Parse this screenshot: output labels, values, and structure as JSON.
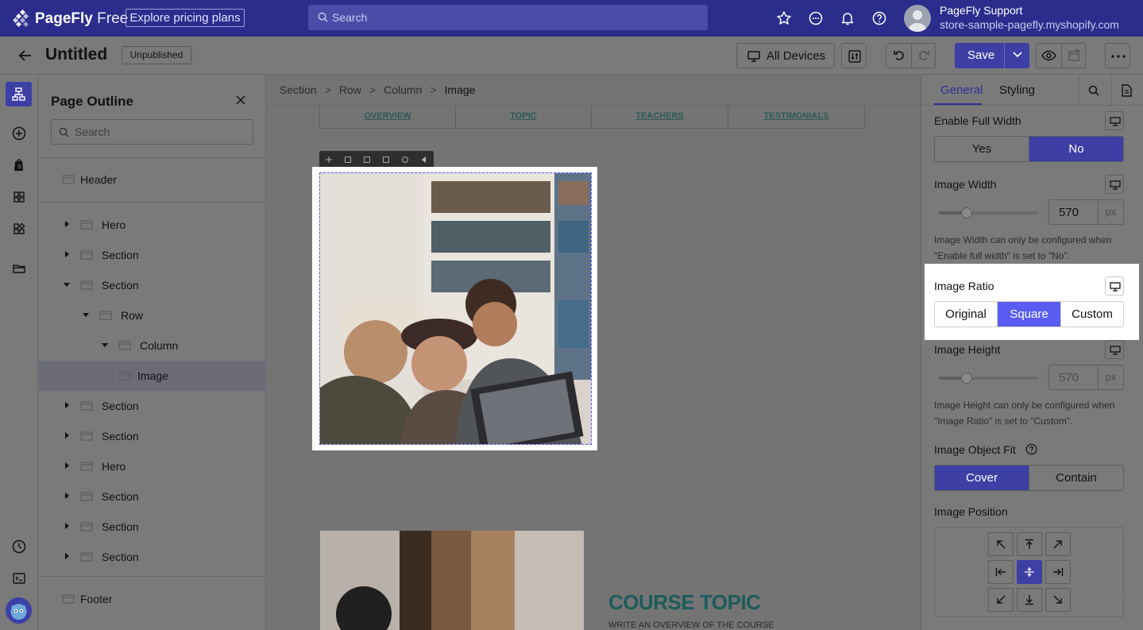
{
  "topbar": {
    "brand_name": "PageFly",
    "brand_tier": "Free",
    "pricing_label": "Explore pricing plans",
    "search_placeholder": "Search",
    "user_name": "PageFly Support",
    "user_store": "store-sample-pagefly.myshopify.com",
    "icons": [
      "star-icon",
      "chat-icon",
      "bell-icon",
      "help-icon"
    ]
  },
  "header": {
    "title": "Untitled",
    "status": "Unpublished",
    "devices_label": "All Devices",
    "save_label": "Save"
  },
  "outline": {
    "title": "Page Outline",
    "search_placeholder": "Search",
    "items": [
      {
        "label": "Header",
        "level": 0,
        "expandable": false,
        "selected": false
      },
      {
        "label": "Hero",
        "level": 0,
        "expandable": true,
        "expanded": false,
        "selected": false
      },
      {
        "label": "Section",
        "level": 0,
        "expandable": true,
        "expanded": false,
        "selected": false
      },
      {
        "label": "Section",
        "level": 0,
        "expandable": true,
        "expanded": true,
        "selected": false
      },
      {
        "label": "Row",
        "level": 1,
        "expandable": true,
        "expanded": true,
        "selected": false
      },
      {
        "label": "Column",
        "level": 2,
        "expandable": true,
        "expanded": true,
        "selected": false
      },
      {
        "label": "Image",
        "level": 3,
        "expandable": false,
        "selected": true
      },
      {
        "label": "Section",
        "level": 0,
        "expandable": true,
        "expanded": false,
        "selected": false
      },
      {
        "label": "Section",
        "level": 0,
        "expandable": true,
        "expanded": false,
        "selected": false
      },
      {
        "label": "Hero",
        "level": 0,
        "expandable": true,
        "expanded": false,
        "selected": false
      },
      {
        "label": "Section",
        "level": 0,
        "expandable": true,
        "expanded": false,
        "selected": false
      },
      {
        "label": "Section",
        "level": 0,
        "expandable": true,
        "expanded": false,
        "selected": false
      },
      {
        "label": "Section",
        "level": 0,
        "expandable": true,
        "expanded": false,
        "selected": false
      },
      {
        "label": "Footer",
        "level": 0,
        "expandable": false,
        "selected": false
      }
    ]
  },
  "canvas": {
    "breadcrumb": [
      "Section",
      "Row",
      "Column",
      "Image"
    ],
    "nav_links": [
      "OVERVIEW",
      "TOPIC",
      "TEACHERS",
      "TESTIMONIALS"
    ],
    "course_title": "COURSE TOPIC",
    "course_subtitle": "WRITE AN OVERVIEW OF THE COURSE"
  },
  "inspector": {
    "tabs": [
      "General",
      "Styling"
    ],
    "active_tab": "General",
    "full_width": {
      "label": "Enable Full Width",
      "options": [
        "Yes",
        "No"
      ],
      "selected": "No"
    },
    "image_width": {
      "label": "Image Width",
      "value": "570",
      "unit": "px",
      "hint": "Image Width can only be configured when \"Enable full width\" is set to \"No\"."
    },
    "image_ratio": {
      "label": "Image Ratio",
      "options": [
        "Original",
        "Square",
        "Custom"
      ],
      "selected": "Square"
    },
    "image_height": {
      "label": "Image Height",
      "value": "570",
      "unit": "px",
      "hint": "Image Height can only be configured when \"Image Ratio\" is set to \"Custom\"."
    },
    "object_fit": {
      "label": "Image Object Fit",
      "options": [
        "Cover",
        "Contain"
      ],
      "selected": "Cover"
    },
    "position": {
      "label": "Image Position",
      "selected": "center"
    }
  },
  "colors": {
    "brand": "#2a2d8c",
    "accent": "#5a5cf2",
    "course_title": "#1d5b5a"
  }
}
